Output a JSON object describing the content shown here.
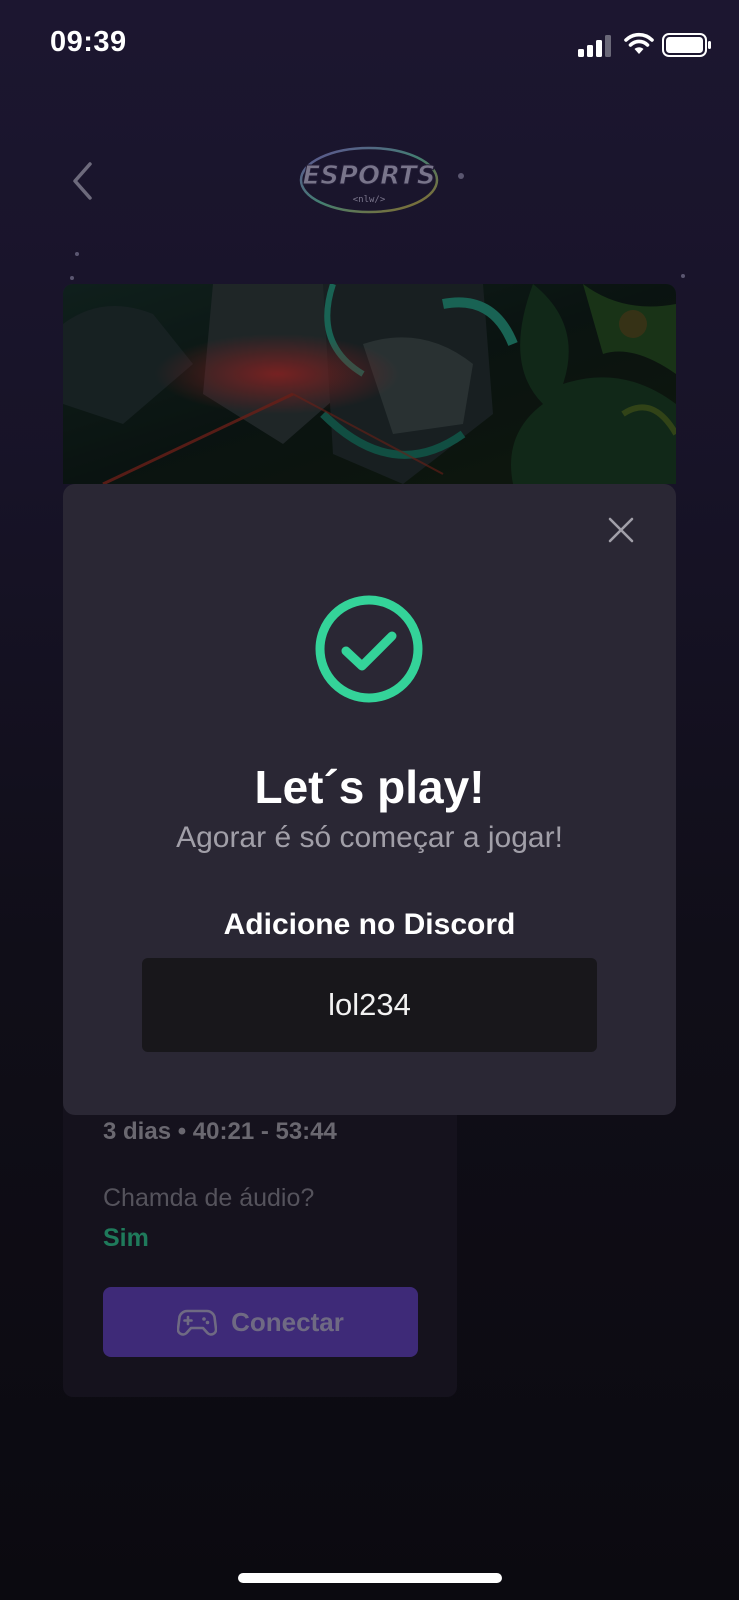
{
  "status_bar": {
    "time": "09:39",
    "signal_icon": "cellular-signal-icon",
    "wifi_icon": "wifi-icon",
    "battery_icon": "battery-icon"
  },
  "header": {
    "back_icon": "chevron-left-icon",
    "logo_text": "ESPORTS",
    "logo_subtext": "<nlw/>"
  },
  "game_card": {
    "schedule": "3 dias • 40:21 - 53:44",
    "audio_label": "Chamda de áudio?",
    "audio_value": "Sim",
    "connect_label": "Conectar",
    "connect_icon": "game-controller-icon"
  },
  "modal": {
    "close_icon": "close-icon",
    "status_icon": "check-circle-icon",
    "title": "Let´s play!",
    "subtitle": "Agorar é só começar a jogar!",
    "discord_label": "Adicione no Discord",
    "discord_id": "lol234"
  },
  "colors": {
    "accent_green": "#34d399",
    "audio_green_dim": "#1f7a5b",
    "modal_bg": "#2a2734",
    "discord_box_bg": "#18171b",
    "connect_button_bg": "#3e2a78"
  }
}
